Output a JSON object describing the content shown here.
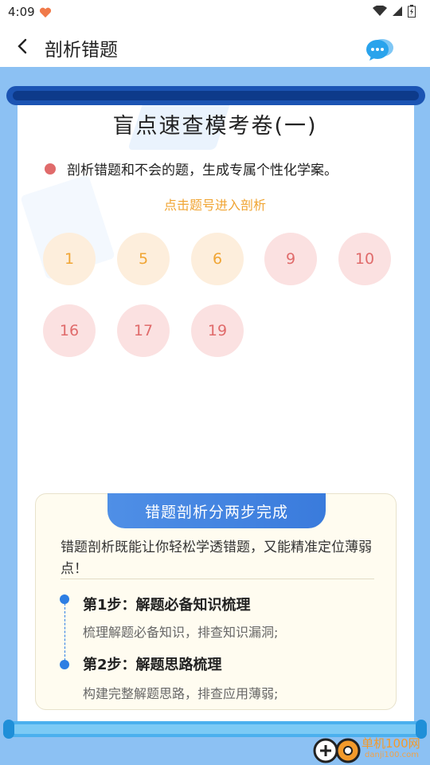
{
  "status": {
    "time": "4:09"
  },
  "header": {
    "title": "剖析错题"
  },
  "exam": {
    "title": "盲点速查模考卷(一)",
    "intro": "剖析错题和不会的题，生成专属个性化学案。",
    "hint": "点击题号进入剖析",
    "questions": [
      {
        "num": "1",
        "status": "correct"
      },
      {
        "num": "5",
        "status": "correct"
      },
      {
        "num": "6",
        "status": "correct"
      },
      {
        "num": "9",
        "status": "wrong"
      },
      {
        "num": "10",
        "status": "wrong"
      },
      {
        "num": "16",
        "status": "wrong"
      },
      {
        "num": "17",
        "status": "wrong"
      },
      {
        "num": "19",
        "status": "wrong"
      }
    ]
  },
  "info": {
    "banner": "错题剖析分两步完成",
    "intro": "错题剖析既能让你轻松学透错题，又能精准定位薄弱点！",
    "steps": [
      {
        "title": "第1步：解题必备知识梳理",
        "desc": "梳理解题必备知识，排查知识漏洞;"
      },
      {
        "title": "第2步：解题思路梳理",
        "desc": "构建完整解题思路，排查应用薄弱;"
      }
    ]
  },
  "watermark": {
    "name": "单机100网",
    "url": "danji100.com"
  },
  "colors": {
    "correct_bg": "#fdeedc",
    "correct_fg": "#f0a534",
    "wrong_bg": "#fbe1e1",
    "wrong_fg": "#e06b6b",
    "accent": "#2d7ee3"
  }
}
